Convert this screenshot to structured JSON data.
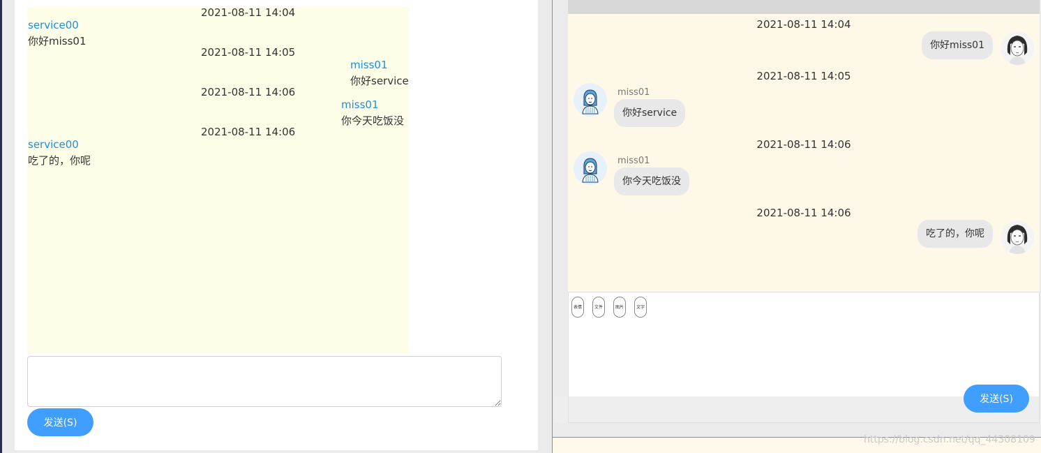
{
  "left": {
    "messages": [
      {
        "time": "2021-08-11 14:04",
        "name": "service00",
        "text": "你好miss01",
        "side": "left"
      },
      {
        "time": "2021-08-11 14:05",
        "name": "miss01",
        "text": "你好service",
        "side": "right"
      },
      {
        "time": "2021-08-11 14:06",
        "name": "miss01",
        "text": "你今天吃饭没",
        "side": "right"
      },
      {
        "time": "2021-08-11 14:06",
        "name": "service00",
        "text": "吃了的，你呢",
        "side": "left"
      }
    ],
    "input_value": "",
    "send_label": "发送(S)"
  },
  "right": {
    "messages": [
      {
        "time": "2021-08-11 14:04",
        "text": "你好miss01",
        "side": "right",
        "avatar": "girl-avatar-icon"
      },
      {
        "time": "2021-08-11 14:05",
        "name": "miss01",
        "text": "你好service",
        "side": "left",
        "avatar": "service-avatar-icon"
      },
      {
        "time": "2021-08-11 14:06",
        "name": "miss01",
        "text": "你今天吃饭没",
        "side": "left",
        "avatar": "service-avatar-icon"
      },
      {
        "time": "2021-08-11 14:06",
        "text": "吃了的，你呢",
        "side": "right",
        "avatar": "girl-avatar-icon"
      }
    ],
    "toolbar": {
      "emoji_label": "表情",
      "file_label": "文件",
      "image_label": "图片",
      "text_label": "文字"
    },
    "send_label": "发送(S)"
  },
  "watermark": "https://blog.csdn.net/qq_44308109",
  "colors": {
    "accent": "#409eff",
    "name_blue": "#1e90d8",
    "left_log_bg": "#fefee8",
    "right_log_bg": "#fef8e8",
    "bubble_bg": "#e8e8e8"
  }
}
